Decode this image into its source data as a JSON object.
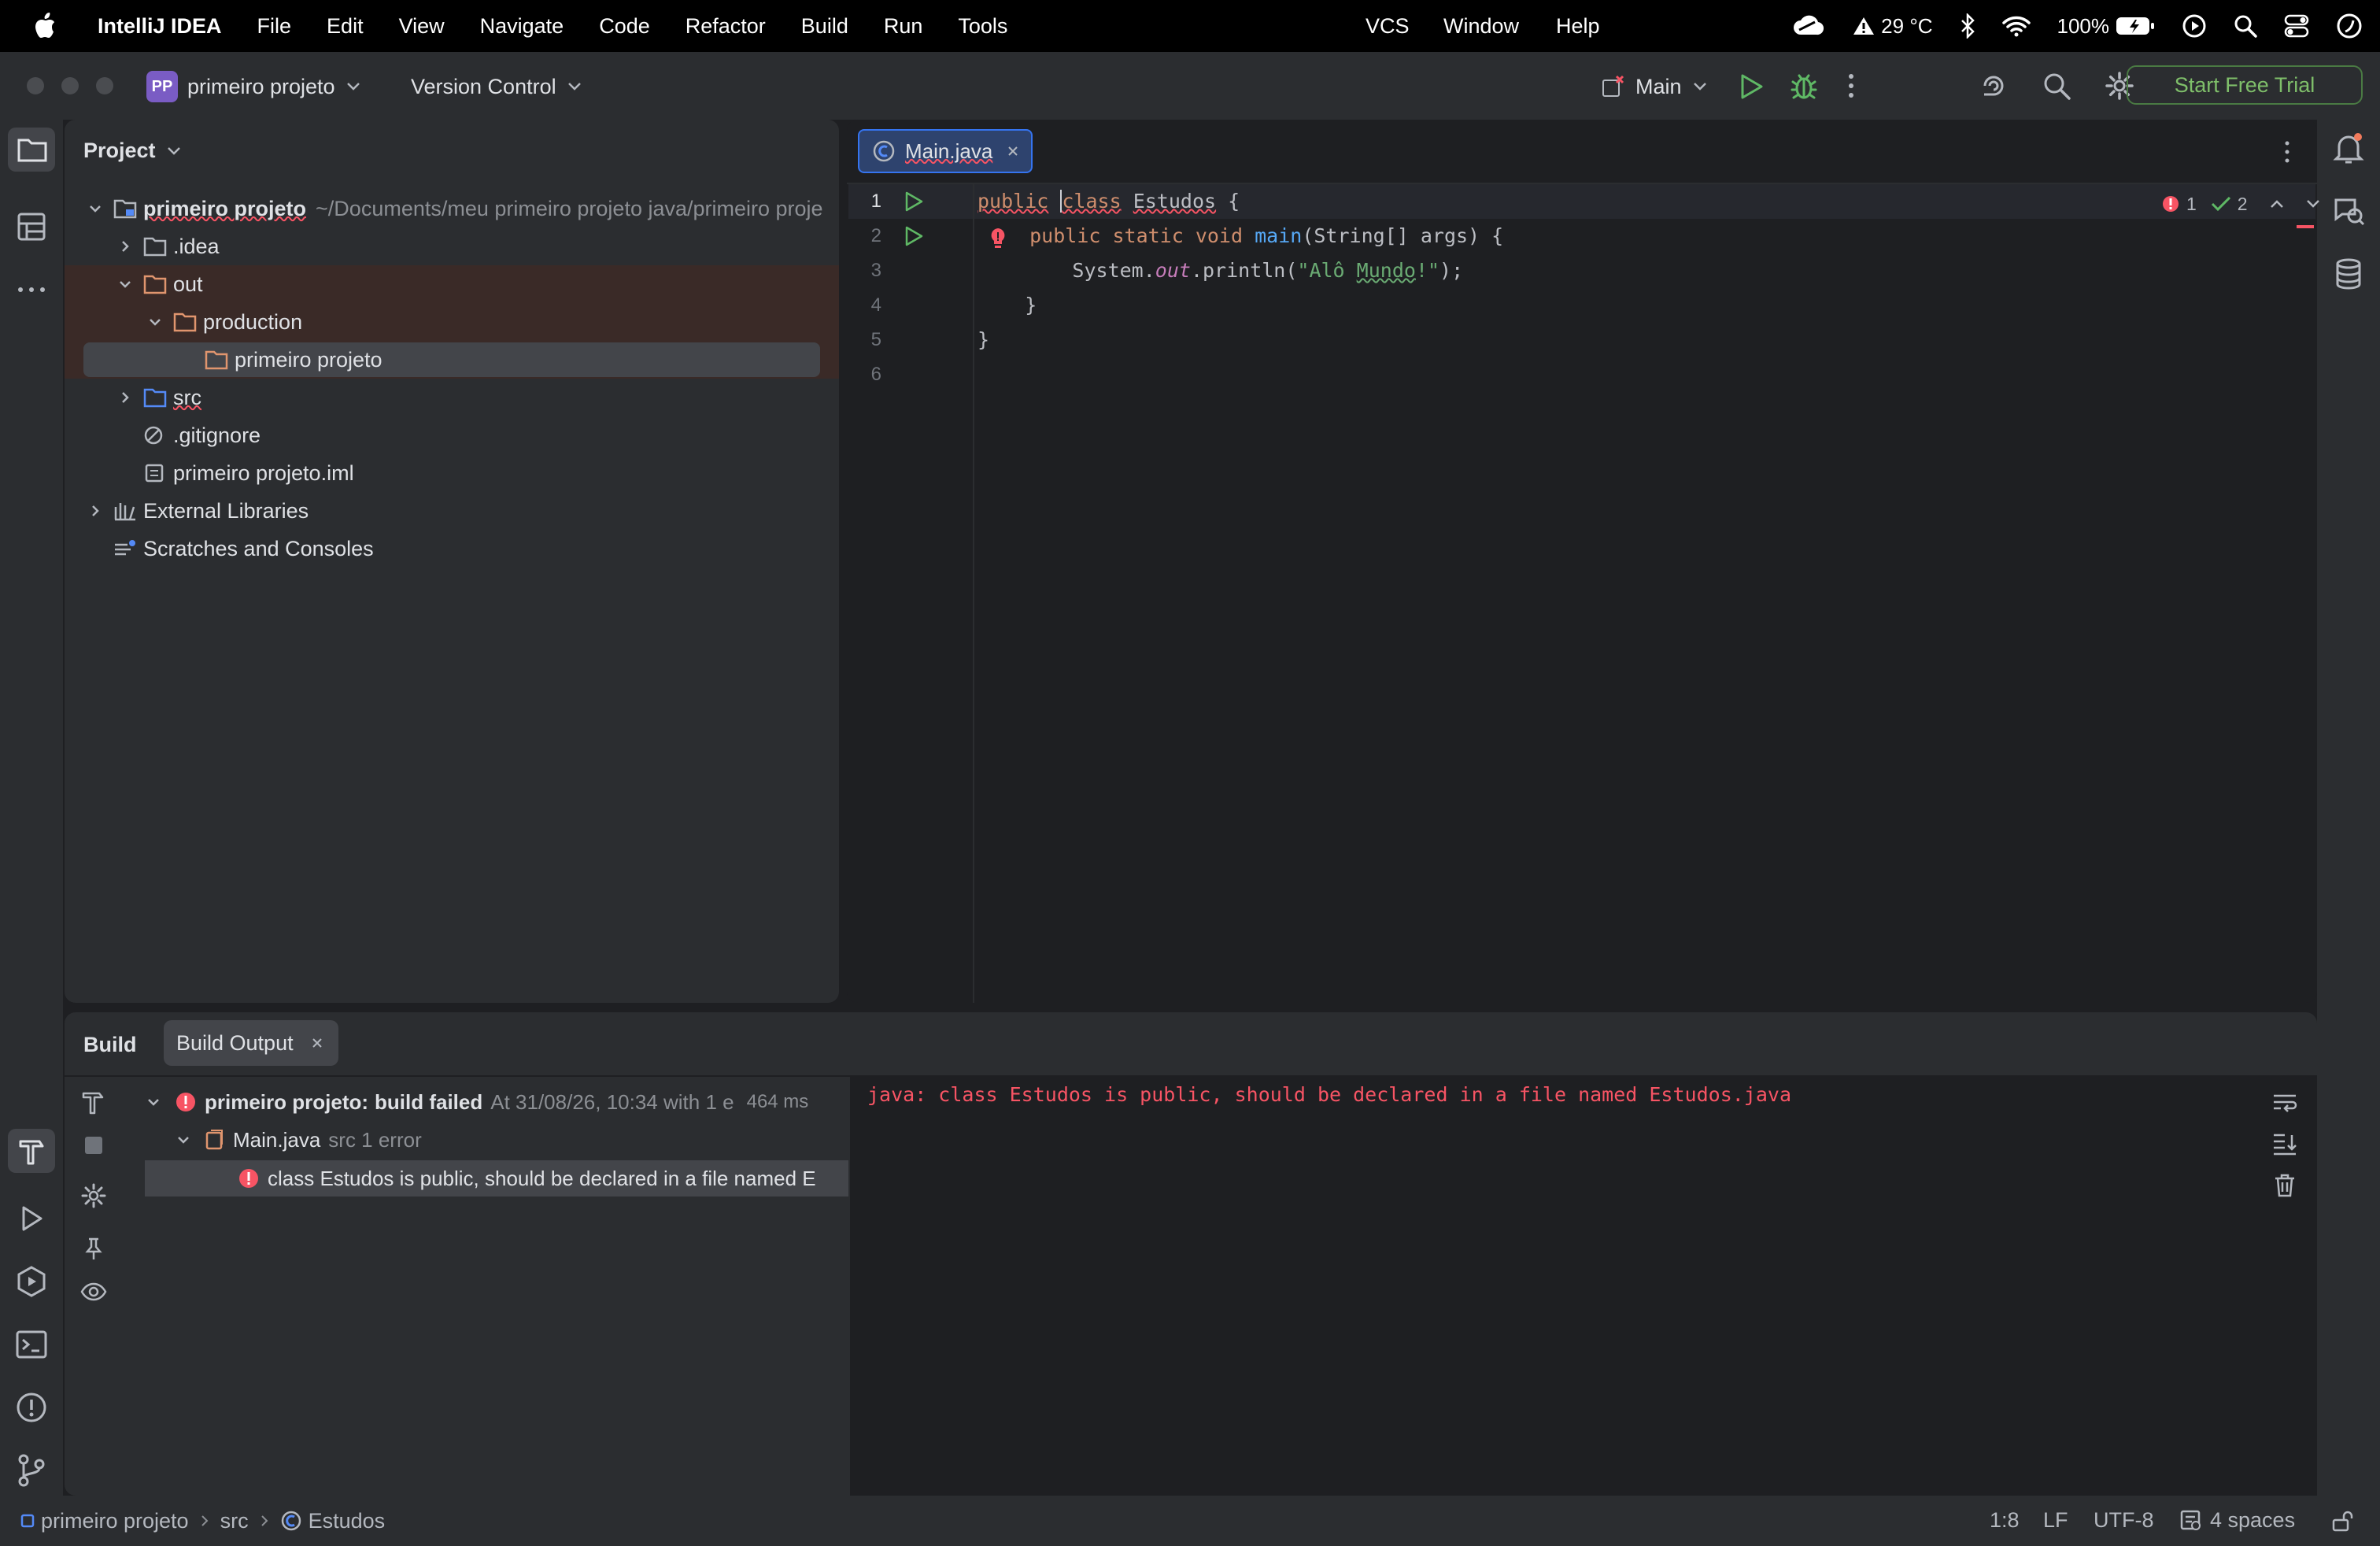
{
  "menubar": {
    "app": "IntelliJ IDEA",
    "items": [
      "File",
      "Edit",
      "View",
      "Navigate",
      "Code",
      "Refactor",
      "Build",
      "Run",
      "Tools"
    ],
    "items_right": [
      "VCS",
      "Window",
      "Help"
    ],
    "weather": "29 °C",
    "battery": "100%"
  },
  "toolbar": {
    "project_badge": "PP",
    "project_name": "primeiro projeto",
    "vcs": "Version Control",
    "run_config": "Main",
    "trial": "Start Free Trial"
  },
  "project_panel": {
    "title": "Project",
    "tree": [
      {
        "label": "primeiro projeto",
        "sub": "~/Documents/meu primeiro projeto java/primeiro proje"
      },
      {
        "label": ".idea"
      },
      {
        "label": "out"
      },
      {
        "label": "production"
      },
      {
        "label": "primeiro projeto"
      },
      {
        "label": "src"
      },
      {
        "label": ".gitignore"
      },
      {
        "label": "primeiro projeto.iml"
      },
      {
        "label": "External Libraries"
      },
      {
        "label": "Scratches and Consoles"
      }
    ]
  },
  "editor": {
    "tab": "Main.java",
    "line_numbers": [
      "1",
      "2",
      "3",
      "4",
      "5",
      "6"
    ],
    "code": {
      "l1_kw1": "public",
      "l1_kw2": "class",
      "l1_name": "Estudos",
      "l1_brace": "{",
      "l2_kw": "public static void",
      "l2_fn": "main",
      "l2_rest": "(String[] args) {",
      "l3_sys": "System.",
      "l3_out": "out",
      "l3_println": ".println(",
      "l3_str1": "\"Alô ",
      "l3_str2": "Mundo",
      "l3_str3": "!\"",
      "l3_end": ");",
      "l4": "}",
      "l5": "}"
    },
    "inspections": {
      "errors": "1",
      "warnings": "2"
    }
  },
  "build": {
    "title": "Build",
    "tab": "Build Output",
    "tree": {
      "root_label": "primeiro projeto:",
      "root_status": "build failed",
      "root_time": "At 31/08/26, 10:34 with 1 e",
      "root_duration": "464 ms",
      "file": "Main.java",
      "file_sub": "src 1 error",
      "error": "class Estudos is public, should be declared in a file named E"
    },
    "output": "java: class Estudos is public, should be declared in a file named Estudos.java"
  },
  "statusbar": {
    "breadcrumbs": [
      "primeiro projeto",
      "src",
      "Estudos"
    ],
    "position": "1:8",
    "line_sep": "LF",
    "encoding": "UTF-8",
    "indent": "4 spaces"
  },
  "colors": {
    "accent": "#3574f0",
    "error": "#f75464",
    "trial": "#7fbf6a"
  }
}
